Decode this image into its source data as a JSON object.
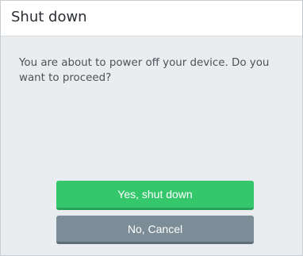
{
  "dialog": {
    "title": "Shut down",
    "message": "You are about to power off your device. Do you want to proceed?",
    "confirm_label": "Yes, shut down",
    "cancel_label": "No, Cancel"
  },
  "colors": {
    "confirm": "#34c76b",
    "cancel": "#7d8d97",
    "body_background": "#eaedf0",
    "header_background": "#ffffff"
  }
}
